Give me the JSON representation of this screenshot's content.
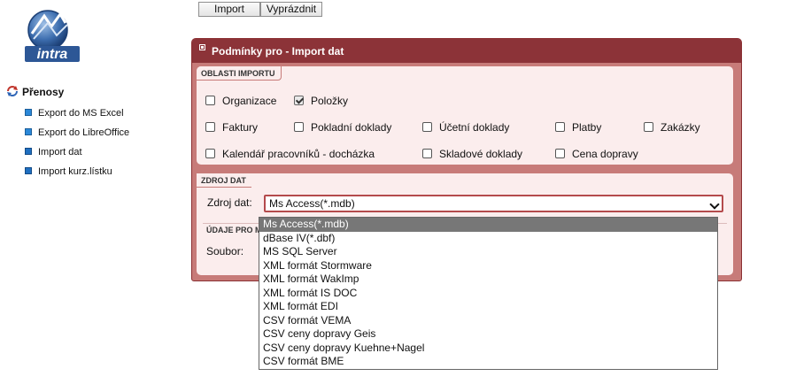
{
  "toolbar": {
    "import_label": "Import",
    "clear_label": "Vyprázdnit"
  },
  "logo": {
    "text": "intra"
  },
  "nav": {
    "title": "Přenosy",
    "items": [
      {
        "label": "Export do MS Excel"
      },
      {
        "label": "Export do LibreOffice"
      },
      {
        "label": "Import dat"
      },
      {
        "label": "Import kurz.lístku"
      }
    ]
  },
  "panel": {
    "title": "Podmínky pro - Import dat",
    "areas_label": "OBLASTI IMPORTU",
    "areas": [
      {
        "label": "Organizace",
        "checked": false
      },
      {
        "label": "Položky",
        "checked": true
      },
      {
        "label": "Faktury",
        "checked": false
      },
      {
        "label": "Pokladní doklady",
        "checked": false
      },
      {
        "label": "Účetní doklady",
        "checked": false
      },
      {
        "label": "Platby",
        "checked": false
      },
      {
        "label": "Zakázky",
        "checked": false
      },
      {
        "label": "Kalendář pracovníků - docházka",
        "checked": false
      },
      {
        "label": "Skladové doklady",
        "checked": false
      },
      {
        "label": "Cena dopravy",
        "checked": false
      }
    ],
    "source_label": "ZDROJ DAT",
    "source_field_label": "Zdroj dat:",
    "source_value": "Ms Access(*.mdb)",
    "file_section_label": "ÚDAJE PRO M",
    "file_label": "Soubor:"
  },
  "dropdown": {
    "options": [
      "Ms Access(*.mdb)",
      "dBase IV(*.dbf)",
      "MS SQL Server",
      "XML formát Stormware",
      "XML formát WakImp",
      "XML formát IS DOC",
      "XML formát EDI",
      "CSV formát VEMA",
      "CSV ceny dopravy Geis",
      "CSV ceny dopravy Kuehne+Nagel",
      "CSV formát BME"
    ],
    "selected_index": 0
  },
  "colors": {
    "header": "#8c3338",
    "panel_bg": "#c77b79",
    "section_bg": "#fbeded",
    "select_border": "#b44a4c"
  }
}
